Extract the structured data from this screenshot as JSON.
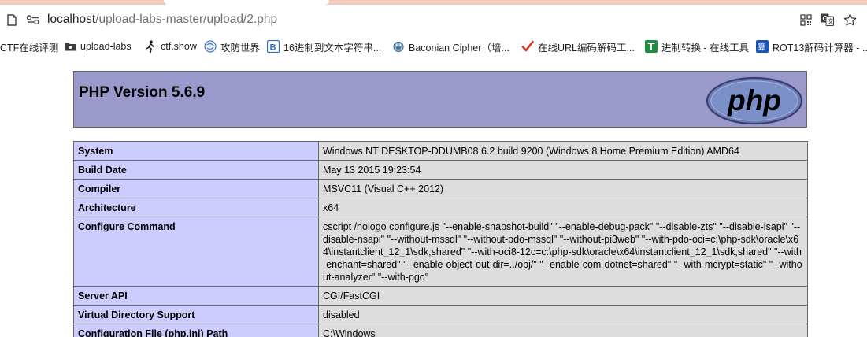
{
  "browser": {
    "url_host": "localhost",
    "url_path": "/upload-labs-master/upload/2.php",
    "icons": [
      "page-icon",
      "site-settings-icon",
      "qr-code-icon",
      "translate-icon",
      "bookmark-star-icon"
    ]
  },
  "bookmarks": [
    {
      "label": "CTF在线评测",
      "icon": "none"
    },
    {
      "label": "upload-labs",
      "icon": "folder-icon"
    },
    {
      "label": "ctf.show",
      "icon": "runner-icon"
    },
    {
      "label": "攻防世界",
      "icon": "globe-icon"
    },
    {
      "label": "16进制到文本字符串...",
      "icon": "b-icon"
    },
    {
      "label": "Baconian Cipher（培...",
      "icon": "pig-icon"
    },
    {
      "label": "在线URL编码解码工...",
      "icon": "checkmark-icon"
    },
    {
      "label": "进制转换 - 在线工具",
      "icon": "t-icon"
    },
    {
      "label": "ROT13解码计算器 - ...",
      "icon": "calc-icon"
    }
  ],
  "phpinfo": {
    "title": "PHP Version 5.6.9",
    "logo_text": "php",
    "rows": [
      {
        "key": "System",
        "value": "Windows NT DESKTOP-DDUMB08 6.2 build 9200 (Windows 8 Home Premium Edition) AMD64"
      },
      {
        "key": "Build Date",
        "value": "May 13 2015 19:23:54"
      },
      {
        "key": "Compiler",
        "value": "MSVC11 (Visual C++ 2012)"
      },
      {
        "key": "Architecture",
        "value": "x64"
      },
      {
        "key": "Configure Command",
        "value": "cscript /nologo configure.js \"--enable-snapshot-build\" \"--enable-debug-pack\" \"--disable-zts\" \"--disable-isapi\" \"--disable-nsapi\" \"--without-mssql\" \"--without-pdo-mssql\" \"--without-pi3web\" \"--with-pdo-oci=c:\\php-sdk\\oracle\\x64\\instantclient_12_1\\sdk,shared\" \"--with-oci8-12c=c:\\php-sdk\\oracle\\x64\\instantclient_12_1\\sdk,shared\" \"--with-enchant=shared\" \"--enable-object-out-dir=../obj/\" \"--enable-com-dotnet=shared\" \"--with-mcrypt=static\" \"--without-analyzer\" \"--with-pgo\""
      },
      {
        "key": "Server API",
        "value": "CGI/FastCGI"
      },
      {
        "key": "Virtual Directory Support",
        "value": "disabled"
      },
      {
        "key": "Configuration File (php.ini) Path",
        "value": "C:\\Windows"
      }
    ]
  },
  "colors": {
    "header_bg": "#9999cc",
    "key_bg": "#ccccff",
    "value_bg": "#dddddd",
    "border": "#666666",
    "tab_strip": "#f4c9bd"
  }
}
